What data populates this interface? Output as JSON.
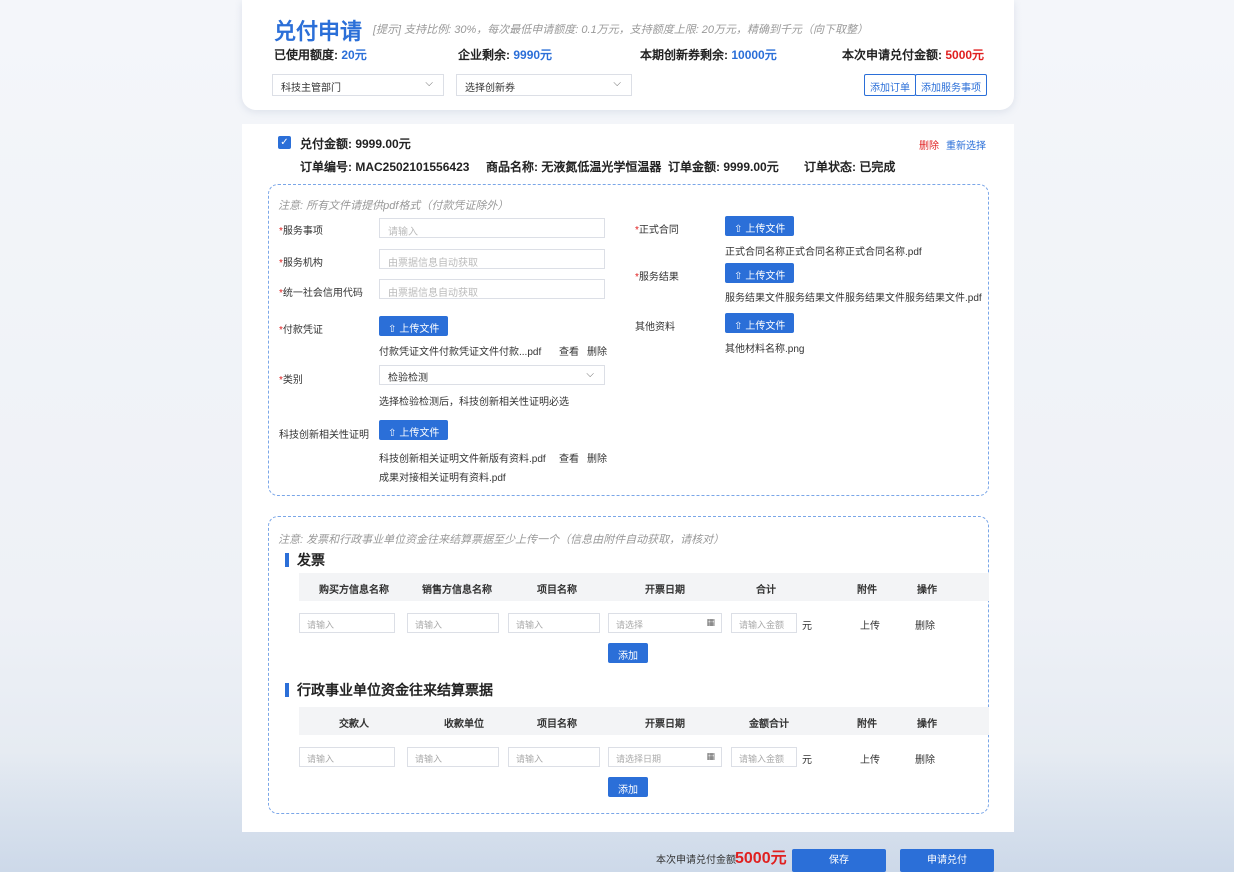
{
  "summary": {
    "title": "兑付申请",
    "hint": "[提示] 支持比例: 30%，每次最低申请额度: 0.1万元，支持额度上限: 20万元，精确到千元（向下取整）",
    "used_label": "已使用额度:",
    "used_value": "20元",
    "remain_label": "企业剩余:",
    "remain_value": "9990元",
    "period_label": "本期创新券剩余:",
    "period_value": "10000元",
    "apply_label": "本次申请兑付金额:",
    "apply_value": "5000元",
    "dept_select": "科技主管部门",
    "voucher_select": "选择创新券",
    "add_order_btn": "添加订单",
    "add_service_btn": "添加服务事项"
  },
  "order": {
    "checked": true,
    "amount_label": "兑付金额: 9999.00元",
    "delete_label": "删除",
    "reselect_label": "重新选择",
    "order_no": "订单编号: MAC2502101556423",
    "product": "商品名称: 无液氮低温光学恒温器",
    "order_amount": "订单金额: 9999.00元",
    "status": "订单状态: 已完成"
  },
  "files": {
    "note": "注意: 所有文件请提供pdf格式（付款凭证除外）",
    "service_item_label": "服务事项",
    "service_item_ph": "请输入",
    "org_label": "服务机构",
    "org_ph": "由票据信息自动获取",
    "credit_label": "统一社会信用代码",
    "credit_ph": "由票据信息自动获取",
    "payment_label": "付款凭证",
    "upload_label": "上传文件",
    "payment_file": "付款凭证文件付款凭证文件付款...pdf",
    "view_label": "查看",
    "delete_label": "删除",
    "category_label": "类别",
    "category_value": "检验检测",
    "category_tip": "选择检验检测后，科技创新相关性证明必选",
    "innovation_label": "科技创新相关性证明",
    "innovation_file1": "科技创新相关证明文件新版有资料.pdf",
    "innovation_file2": "成果对接相关证明有资料.pdf",
    "contract_label": "正式合同",
    "contract_file": "正式合同名称正式合同名称正式合同名称.pdf",
    "result_label": "服务结果",
    "result_file": "服务结果文件服务结果文件服务结果文件服务结果文件.pdf",
    "other_label": "其他资料",
    "other_file": "其他材料名称.png"
  },
  "invoices": {
    "note": "注意: 发票和行政事业单位资金往来结算票据至少上传一个（信息由附件自动获取，请核对）",
    "invoice_title": "发票",
    "invoice_headers": [
      "购买方信息名称",
      "销售方信息名称",
      "项目名称",
      "开票日期",
      "合计",
      "附件",
      "操作"
    ],
    "invoice_row": {
      "buyer_ph": "请输入",
      "seller_ph": "请输入",
      "project_ph": "请输入",
      "date_ph": "请选择",
      "total_ph": "请输入金额",
      "unit": "元",
      "upload": "上传",
      "delete": "删除"
    },
    "add_label": "添加",
    "receipt_title": "行政事业单位资金往来结算票据",
    "receipt_headers": [
      "交款人",
      "收款单位",
      "项目名称",
      "开票日期",
      "金额合计",
      "附件",
      "操作"
    ],
    "receipt_row": {
      "payer_ph": "请输入",
      "payee_ph": "请输入",
      "project_ph": "请输入",
      "date_ph": "请选择日期",
      "total_ph": "请输入金额",
      "unit": "元",
      "upload": "上传",
      "delete": "删除"
    }
  },
  "footer": {
    "amount_label": "本次申请兑付金额",
    "amount_value": "5000元",
    "save_label": "保存",
    "submit_label": "申请兑付"
  },
  "colors": {
    "primary": "#2b6fd8",
    "danger": "#e02020"
  },
  "icons": [
    "chevron-down-icon",
    "checkbox-checked-icon",
    "upload-icon",
    "calendar-icon"
  ]
}
